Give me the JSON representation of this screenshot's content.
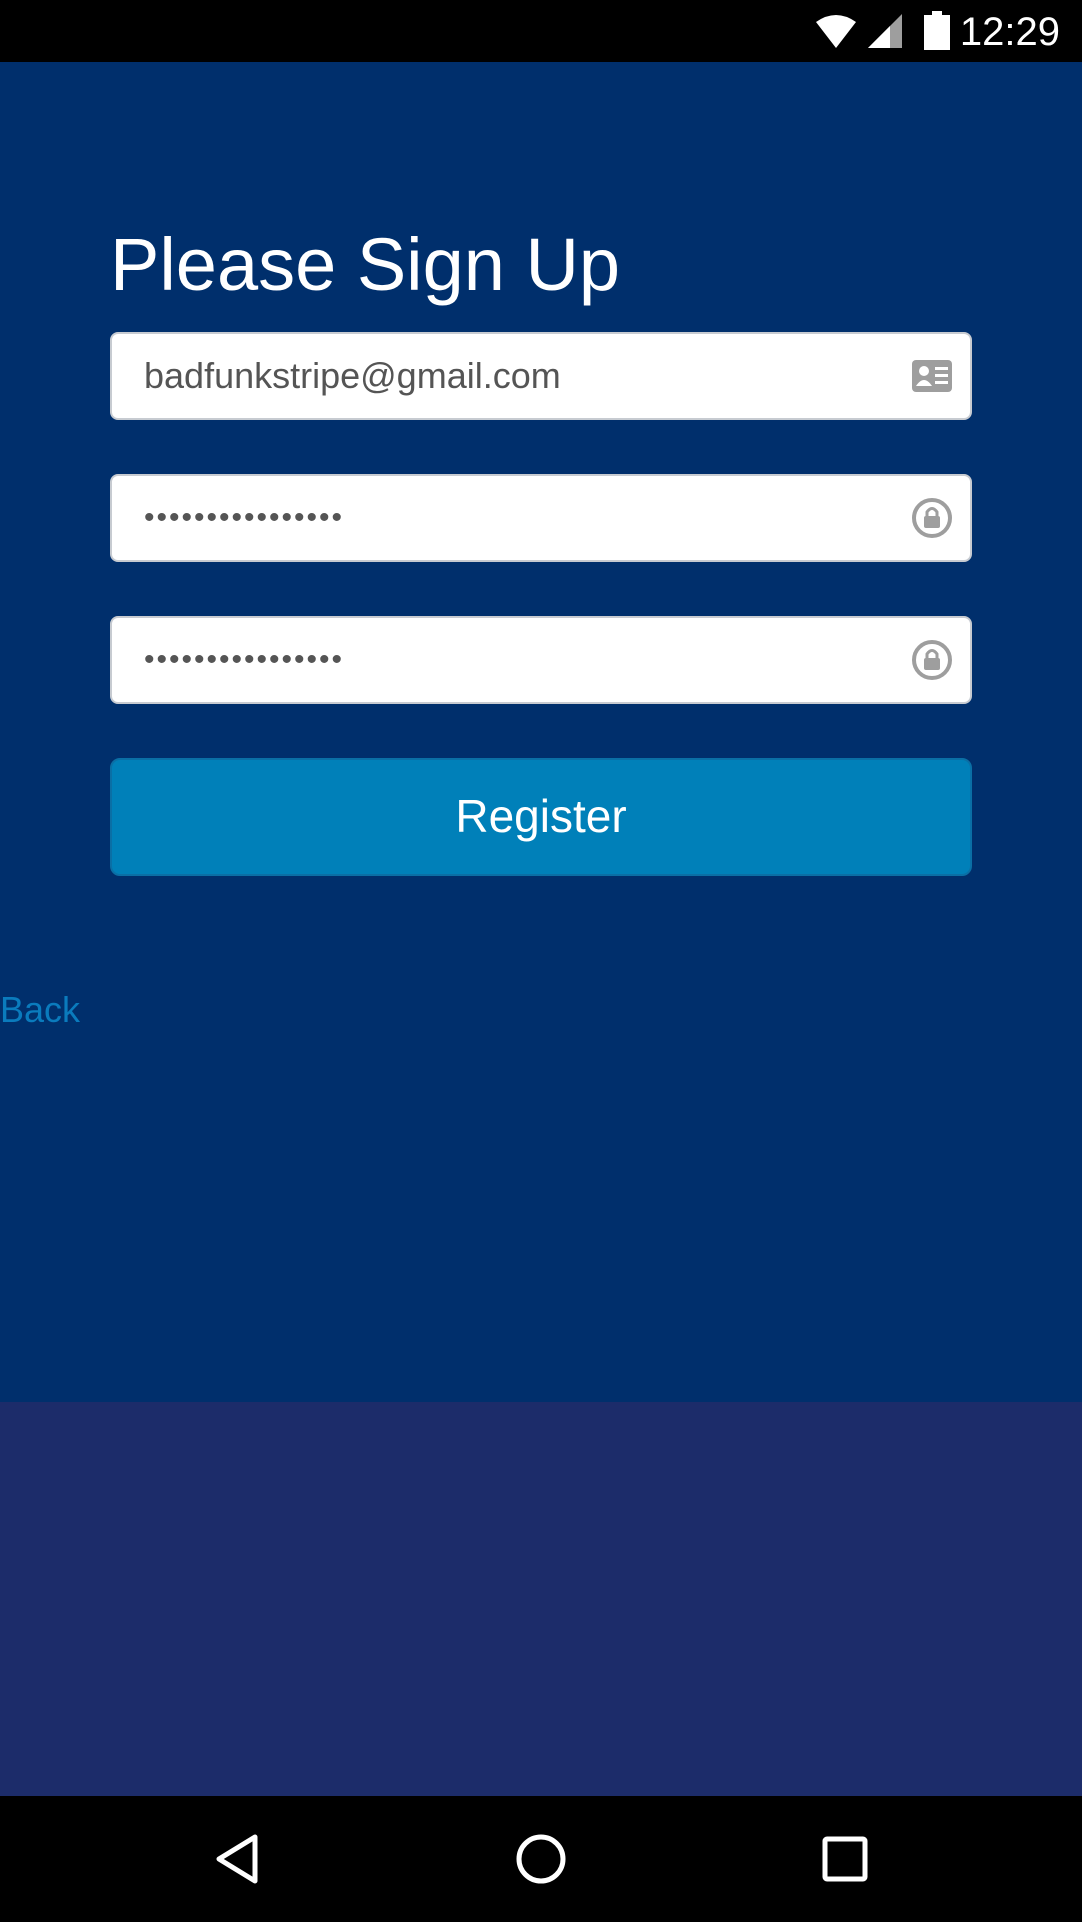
{
  "status_bar": {
    "time": "12:29",
    "icons": [
      "wifi-icon",
      "signal-icon",
      "battery-icon"
    ]
  },
  "signup": {
    "title": "Please Sign Up",
    "email": {
      "value": "badfunkstripe@gmail.com",
      "icon": "contact-card-icon"
    },
    "password": {
      "value": "••••••••••••••••",
      "icon": "lock-icon"
    },
    "confirm_password": {
      "value": "••••••••••••••••",
      "icon": "lock-icon"
    },
    "register_label": "Register",
    "back_label": "Back"
  },
  "nav_bar": {
    "buttons": [
      "back-triangle-icon",
      "home-circle-icon",
      "recents-square-icon"
    ]
  },
  "colors": {
    "background": "#002f6c",
    "lower_band": "#1c2c6a",
    "button": "#0080b9",
    "link": "#0a7bbd"
  }
}
